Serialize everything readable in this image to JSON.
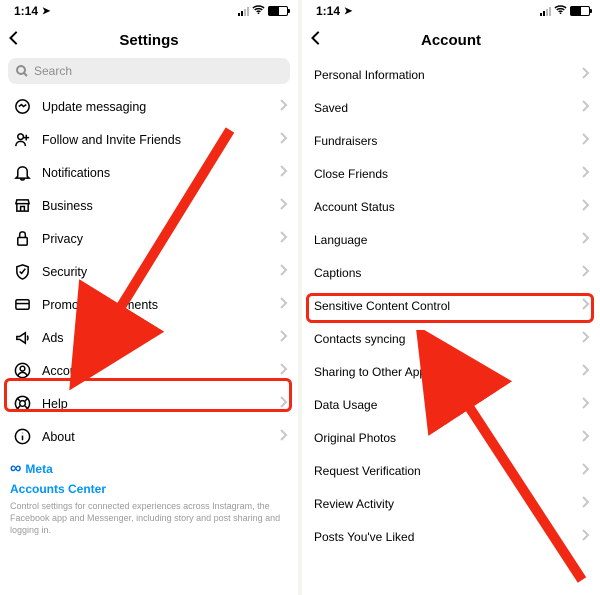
{
  "status": {
    "time": "1:14"
  },
  "left": {
    "title": "Settings",
    "search_placeholder": "Search",
    "items": [
      {
        "name": "update-messaging",
        "label": "Update messaging",
        "icon": "messenger"
      },
      {
        "name": "follow-invite",
        "label": "Follow and Invite Friends",
        "icon": "person-plus"
      },
      {
        "name": "notifications",
        "label": "Notifications",
        "icon": "bell"
      },
      {
        "name": "business",
        "label": "Business",
        "icon": "storefront"
      },
      {
        "name": "privacy",
        "label": "Privacy",
        "icon": "lock"
      },
      {
        "name": "security",
        "label": "Security",
        "icon": "shield"
      },
      {
        "name": "promo-payments",
        "label": "Promotion Payments",
        "icon": "card"
      },
      {
        "name": "ads",
        "label": "Ads",
        "icon": "megaphone"
      },
      {
        "name": "account",
        "label": "Account",
        "icon": "user-circle"
      },
      {
        "name": "help",
        "label": "Help",
        "icon": "lifebuoy"
      },
      {
        "name": "about",
        "label": "About",
        "icon": "info"
      }
    ],
    "footer_brand": "Meta",
    "footer_link": "Accounts Center",
    "footer_text": "Control settings for connected experiences across Instagram, the Facebook app and Messenger, including story and post sharing and logging in."
  },
  "right": {
    "title": "Account",
    "items": [
      {
        "name": "personal-info",
        "label": "Personal Information"
      },
      {
        "name": "saved",
        "label": "Saved"
      },
      {
        "name": "fundraisers",
        "label": "Fundraisers"
      },
      {
        "name": "close-friends",
        "label": "Close Friends"
      },
      {
        "name": "account-status",
        "label": "Account Status"
      },
      {
        "name": "language",
        "label": "Language"
      },
      {
        "name": "captions",
        "label": "Captions"
      },
      {
        "name": "sensitive-content",
        "label": "Sensitive Content Control"
      },
      {
        "name": "contacts-syncing",
        "label": "Contacts syncing"
      },
      {
        "name": "sharing-other-apps",
        "label": "Sharing to Other Apps"
      },
      {
        "name": "data-usage",
        "label": "Data Usage"
      },
      {
        "name": "original-photos",
        "label": "Original Photos"
      },
      {
        "name": "request-verification",
        "label": "Request Verification"
      },
      {
        "name": "review-activity",
        "label": "Review Activity"
      },
      {
        "name": "posts-youve-liked",
        "label": "Posts You've Liked"
      }
    ]
  }
}
